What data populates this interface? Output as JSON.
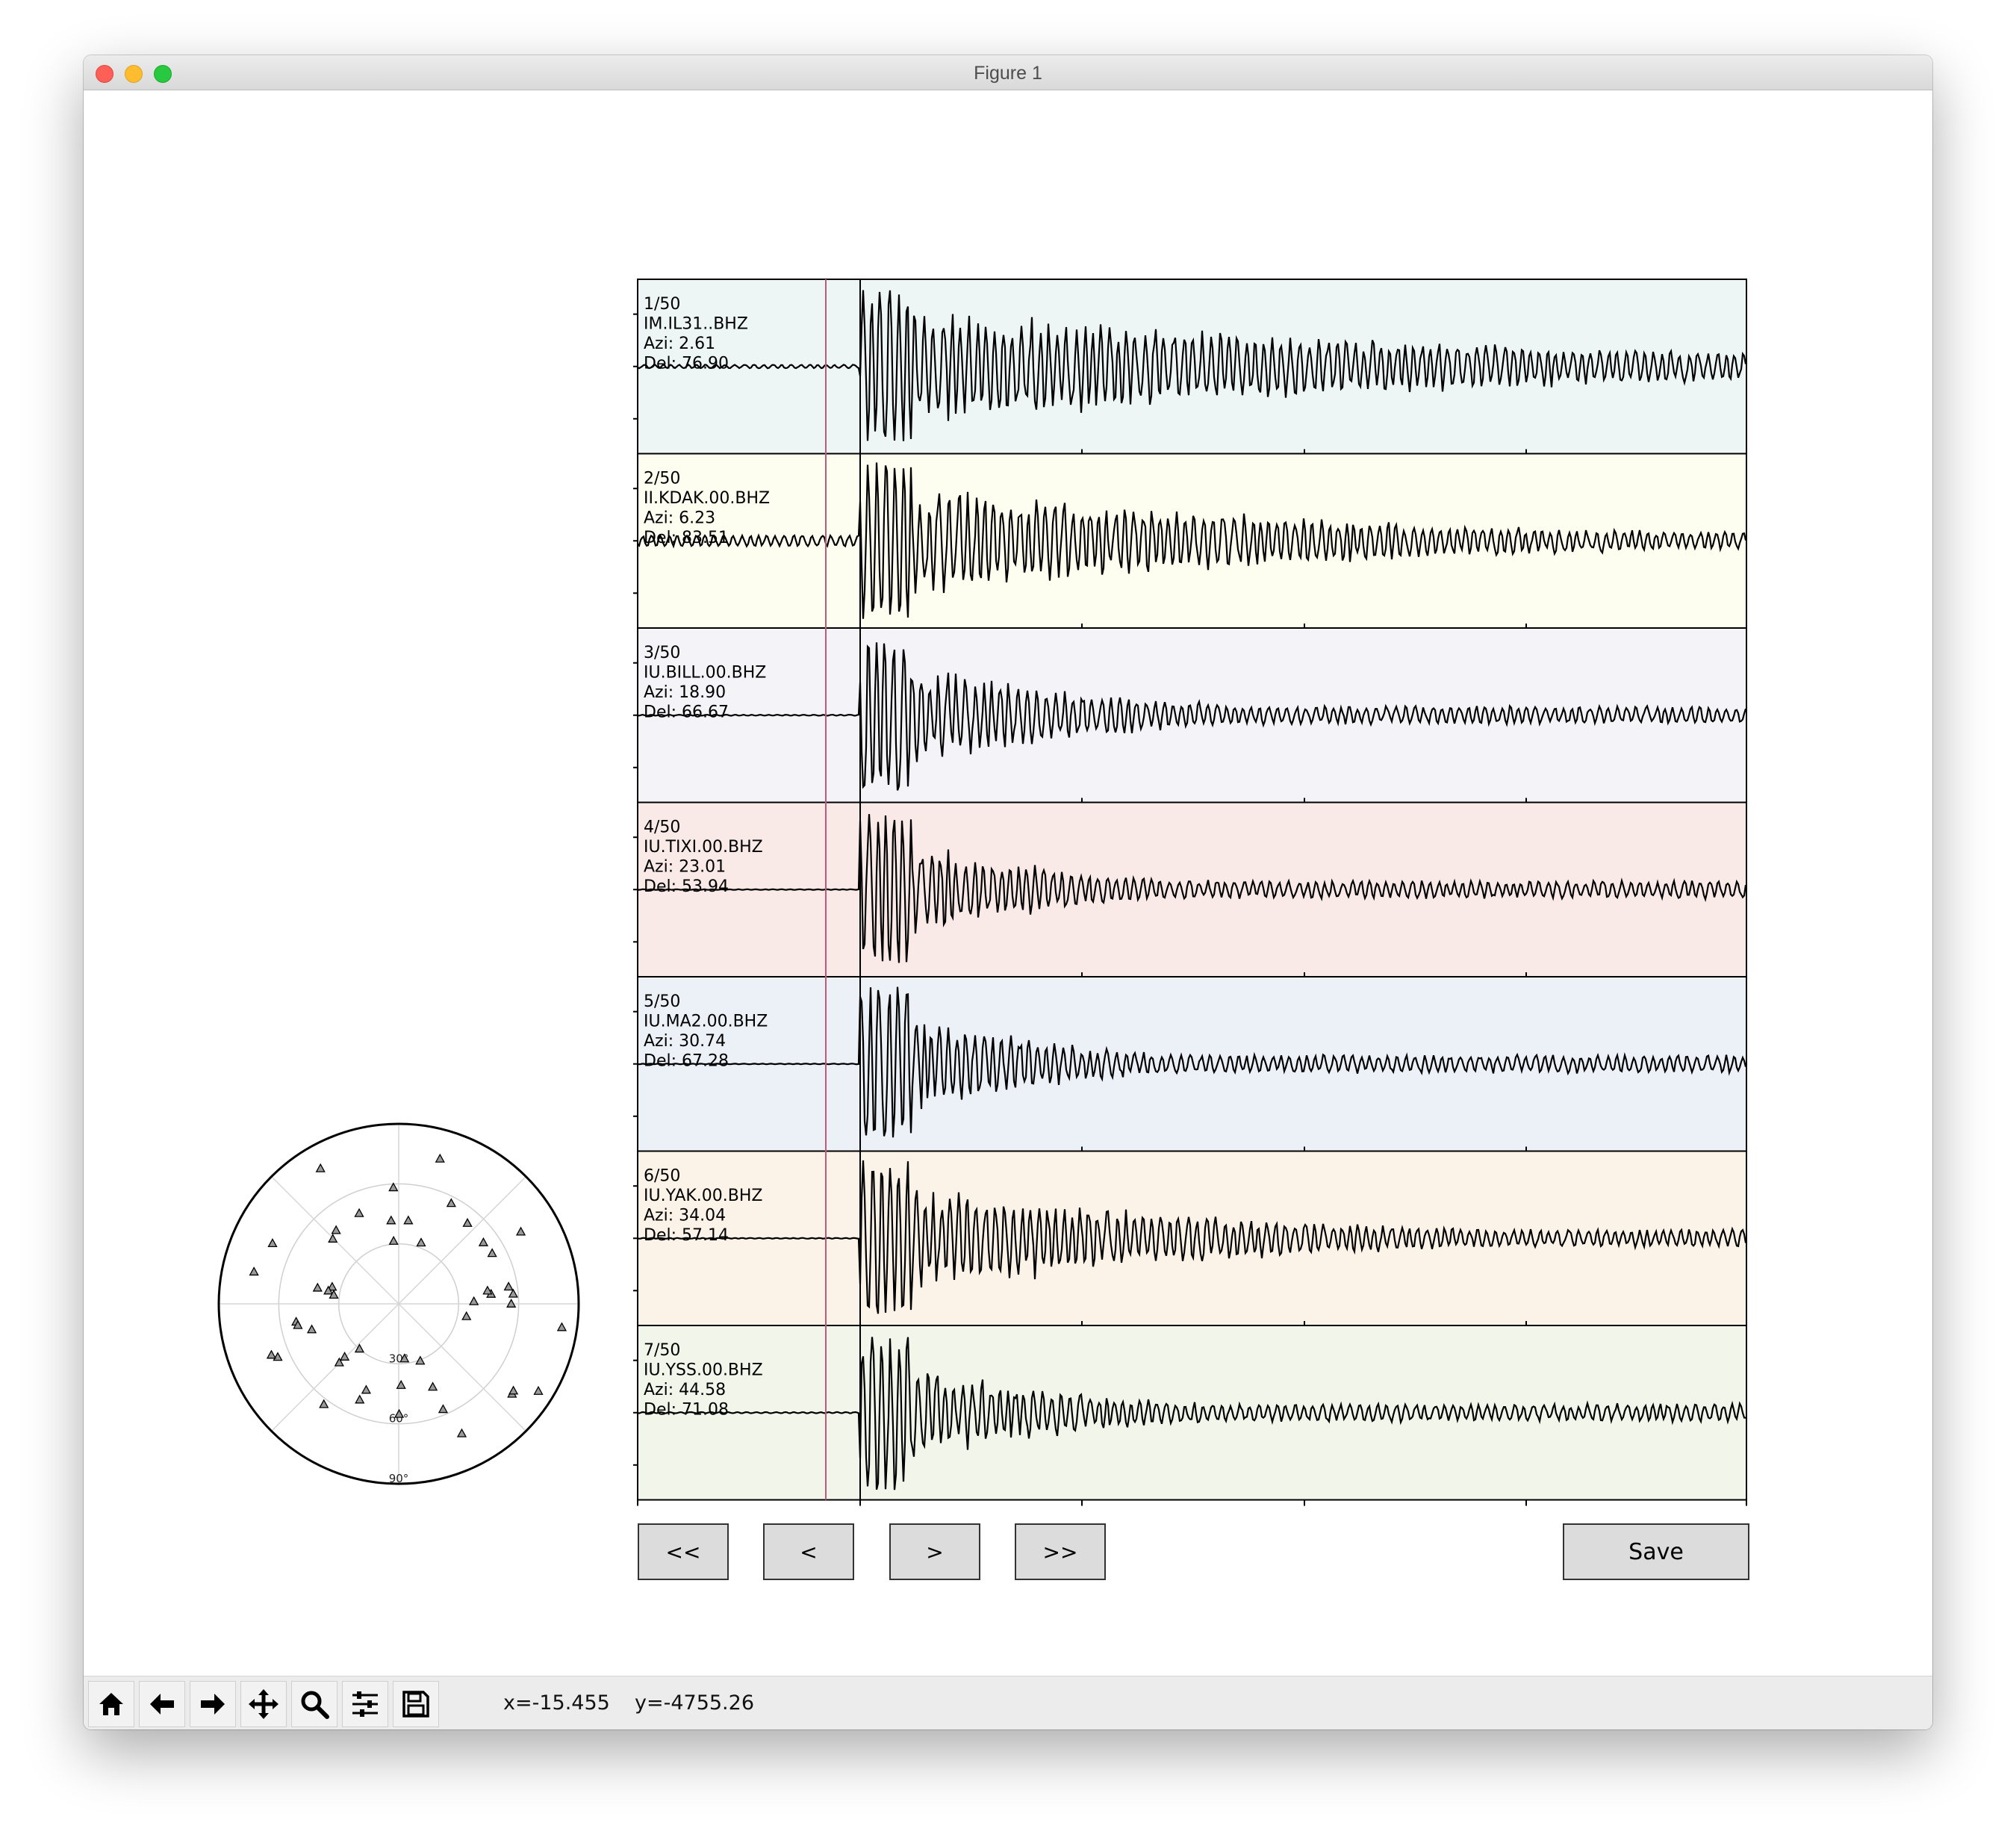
{
  "window": {
    "title": "Figure 1"
  },
  "traces": [
    {
      "index": "1/50",
      "station": "IM.IL31..BHZ",
      "azi": "Azi: 2.61",
      "del": "Del: 76.90",
      "bg": "#eef6f5",
      "amp": 1.0,
      "pre": 0.18,
      "decay": 0.25
    },
    {
      "index": "2/50",
      "station": "II.KDAK.00.BHZ",
      "azi": "Azi: 6.23",
      "del": "Del: 83.51",
      "bg": "#fdfdf0",
      "amp": 1.0,
      "pre": 0.55,
      "decay": 0.35
    },
    {
      "index": "3/50",
      "station": "IU.BILL.00.BHZ",
      "azi": "Azi: 18.90",
      "del": "Del: 66.67",
      "bg": "#f3f3f8",
      "amp": 1.0,
      "pre": 0.05,
      "decay": 0.7
    },
    {
      "index": "4/50",
      "station": "IU.TIXI.00.BHZ",
      "azi": "Azi: 23.01",
      "del": "Del: 53.94",
      "bg": "#f9eae8",
      "amp": 1.0,
      "pre": 0.03,
      "decay": 0.85
    },
    {
      "index": "5/50",
      "station": "IU.MA2.00.BHZ",
      "azi": "Azi: 30.74",
      "del": "Del: 67.28",
      "bg": "#ecf0f7",
      "amp": 1.0,
      "pre": 0.03,
      "decay": 0.85
    },
    {
      "index": "6/50",
      "station": "IU.YAK.00.BHZ",
      "azi": "Azi: 34.04",
      "del": "Del: 57.14",
      "bg": "#fcf3e8",
      "amp": 1.0,
      "pre": 0.04,
      "decay": 0.45
    },
    {
      "index": "7/50",
      "station": "IU.YSS.00.BHZ",
      "azi": "Azi: 44.58",
      "del": "Del: 71.08",
      "bg": "#f2f6ea",
      "amp": 1.0,
      "pre": 0.06,
      "decay": 0.8
    }
  ],
  "polar": {
    "ring_labels": [
      "30°",
      "60°",
      "90°"
    ]
  },
  "buttons": {
    "first": "<<",
    "prev": "<",
    "next": ">",
    "last": ">>",
    "save": "Save"
  },
  "toolbar": {
    "icons": [
      "home-icon",
      "back-arrow-icon",
      "forward-arrow-icon",
      "pan-icon",
      "zoom-icon",
      "configure-subplots-icon",
      "save-figure-icon"
    ],
    "x_readout": "x=-15.455",
    "y_readout": "y=-4755.26"
  }
}
